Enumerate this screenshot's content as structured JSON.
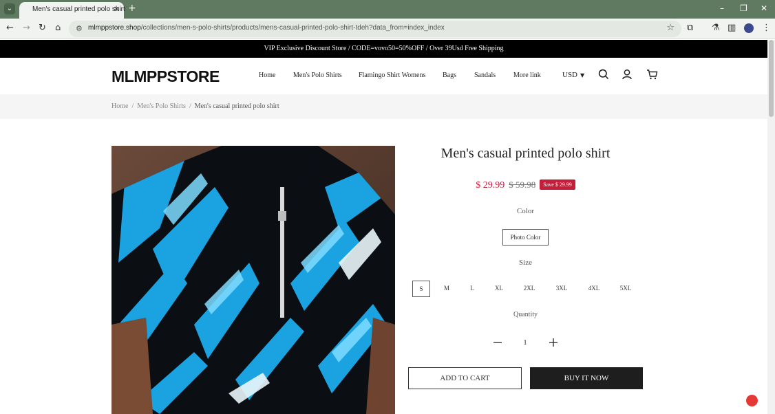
{
  "browser": {
    "tab_title": "Men's casual printed polo shirt",
    "url_domain": "mlmppstore.shop",
    "url_path": "/collections/men-s-polo-shirts/products/mens-casual-printed-polo-shirt-tdeh?data_from=index_index",
    "icons": [
      "back-icon",
      "forward-icon",
      "reload-icon",
      "home-icon",
      "site-info-icon",
      "star-icon",
      "extensions-icon",
      "lab-icon",
      "side-panel-icon",
      "profile-icon",
      "menu-icon"
    ]
  },
  "announcement": "VIP Exclusive Discount Store / CODE=vovo50=50%OFF / Over 39Usd Free Shipping",
  "header": {
    "logo": "MLMPPSTORE",
    "nav": [
      "Home",
      "Men's Polo Shirts",
      "Flamingo Shirt Womens",
      "Bags",
      "Sandals",
      "More link"
    ],
    "currency": "USD"
  },
  "breadcrumb": [
    "Home",
    "Men's Polo Shirts",
    "Men's casual printed polo shirt"
  ],
  "product": {
    "title": "Men's casual printed polo shirt",
    "price": "$ 29.99",
    "compare_price": "$ 59.98",
    "save_badge": "Save $ 29.99",
    "color_label": "Color",
    "color_option": "Photo Color",
    "size_label": "Size",
    "sizes": [
      "S",
      "M",
      "L",
      "XL",
      "2XL",
      "3XL",
      "4XL",
      "5XL"
    ],
    "selected_size": "S",
    "quantity_label": "Quantity",
    "quantity": "1",
    "add_to_cart": "ADD TO CART",
    "buy_now": "BUY IT NOW"
  },
  "colors": {
    "accent": "#c41e3a",
    "announcement_bg": "#000000",
    "buy_button_bg": "#1e1e1e",
    "browser_frame": "#5f7a60"
  }
}
